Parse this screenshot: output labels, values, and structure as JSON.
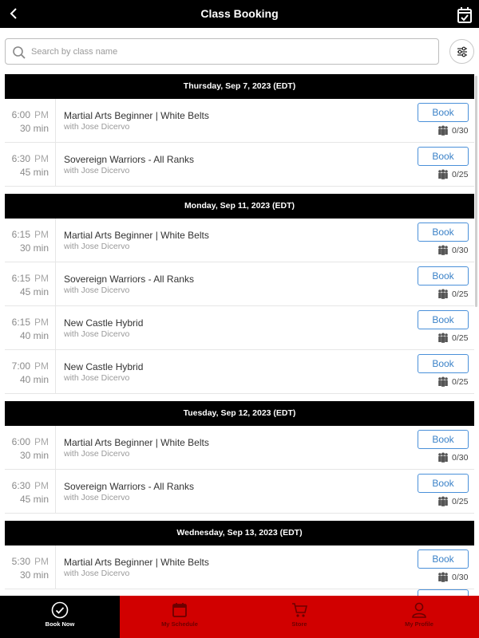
{
  "header": {
    "title": "Class Booking",
    "back_icon": "chevron-left-icon",
    "right_icon": "calendar-check-icon"
  },
  "search": {
    "placeholder": "Search by class name",
    "value": ""
  },
  "days": [
    {
      "date": "Thursday, Sep 7, 2023 (EDT)",
      "classes": [
        {
          "time": "6:00",
          "ampm": "PM",
          "duration": "30 min",
          "name": "Martial Arts Beginner | White Belts",
          "instructor": "with Jose Dicervo",
          "button": "Book",
          "capacity": "0/30"
        },
        {
          "time": "6:30",
          "ampm": "PM",
          "duration": "45 min",
          "name": "Sovereign Warriors - All Ranks",
          "instructor": "with Jose Dicervo",
          "button": "Book",
          "capacity": "0/25"
        }
      ]
    },
    {
      "date": "Monday, Sep 11, 2023 (EDT)",
      "classes": [
        {
          "time": "6:15",
          "ampm": "PM",
          "duration": "30 min",
          "name": "Martial Arts Beginner | White Belts",
          "instructor": "with Jose Dicervo",
          "button": "Book",
          "capacity": "0/30"
        },
        {
          "time": "6:15",
          "ampm": "PM",
          "duration": "45 min",
          "name": "Sovereign Warriors - All Ranks",
          "instructor": "with Jose Dicervo",
          "button": "Book",
          "capacity": "0/25"
        },
        {
          "time": "6:15",
          "ampm": "PM",
          "duration": "40 min",
          "name": "New Castle Hybrid",
          "instructor": "with Jose Dicervo",
          "button": "Book",
          "capacity": "0/25"
        },
        {
          "time": "7:00",
          "ampm": "PM",
          "duration": "40 min",
          "name": "New Castle Hybrid",
          "instructor": "with Jose Dicervo",
          "button": "Book",
          "capacity": "0/25"
        }
      ]
    },
    {
      "date": "Tuesday, Sep 12, 2023 (EDT)",
      "classes": [
        {
          "time": "6:00",
          "ampm": "PM",
          "duration": "30 min",
          "name": "Martial Arts Beginner | White Belts",
          "instructor": "with Jose Dicervo",
          "button": "Book",
          "capacity": "0/30"
        },
        {
          "time": "6:30",
          "ampm": "PM",
          "duration": "45 min",
          "name": "Sovereign Warriors - All Ranks",
          "instructor": "with Jose Dicervo",
          "button": "Book",
          "capacity": "0/25"
        }
      ]
    },
    {
      "date": "Wednesday, Sep 13, 2023 (EDT)",
      "classes": [
        {
          "time": "5:30",
          "ampm": "PM",
          "duration": "30 min",
          "name": "Martial Arts Beginner | White Belts",
          "instructor": "with Jose Dicervo",
          "button": "Book",
          "capacity": "0/30"
        }
      ]
    }
  ],
  "bottom_nav": [
    {
      "label": "Book Now",
      "icon": "check-circle-icon",
      "active": true
    },
    {
      "label": "My Schedule",
      "icon": "calendar-icon",
      "active": false
    },
    {
      "label": "Store",
      "icon": "cart-icon",
      "active": false
    },
    {
      "label": "My Profile",
      "icon": "user-icon",
      "active": false
    }
  ],
  "colors": {
    "header_bg": "#000000",
    "nav_active_bg": "#000000",
    "nav_inactive_bg": "#d10000",
    "accent_blue": "#3b82c8"
  }
}
